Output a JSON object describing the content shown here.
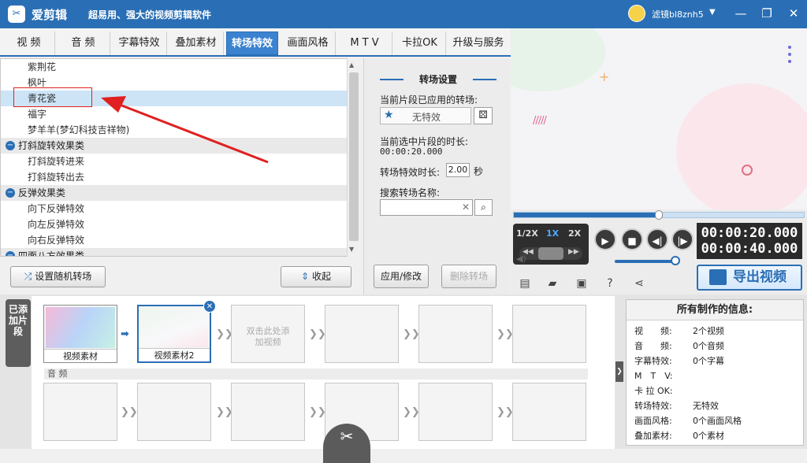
{
  "titlebar": {
    "app_name": "爱剪辑",
    "slogan": "超易用、强大的视频剪辑软件",
    "username": "滤镜bl8znh5"
  },
  "tabs": [
    "视 频",
    "音 频",
    "字幕特效",
    "叠加素材",
    "转场特效",
    "画面风格",
    "M T V",
    "卡拉OK",
    "升级与服务"
  ],
  "active_tab": "转场特效",
  "transition_list": [
    {
      "type": "leaf",
      "label": "紫荆花"
    },
    {
      "type": "leaf",
      "label": "枫叶"
    },
    {
      "type": "leaf",
      "label": "青花瓷",
      "selected": true
    },
    {
      "type": "leaf",
      "label": "福字"
    },
    {
      "type": "leaf",
      "label": "梦羊羊(梦幻科技吉祥物)"
    },
    {
      "type": "category",
      "label": "打斜旋转效果类"
    },
    {
      "type": "leaf",
      "label": "打斜旋转进来"
    },
    {
      "type": "leaf",
      "label": "打斜旋转出去"
    },
    {
      "type": "category",
      "label": "反弹效果类"
    },
    {
      "type": "leaf",
      "label": "向下反弹特效"
    },
    {
      "type": "leaf",
      "label": "向左反弹特效"
    },
    {
      "type": "leaf",
      "label": "向右反弹特效"
    },
    {
      "type": "category",
      "label": "四面八方效果类"
    }
  ],
  "buttons": {
    "random_transition": "设置随机转场",
    "collapse": "收起",
    "apply": "应用/修改",
    "delete": "删除转场"
  },
  "settings": {
    "header": "转场设置",
    "applied_label": "当前片段已应用的转场:",
    "applied_value": "无特效",
    "duration_label": "当前选中片段的时长:",
    "duration_value": "00:00:20.000",
    "effect_duration_label": "转场特效时长:",
    "effect_duration_value": "2.00",
    "seconds_unit": "秒",
    "search_label": "搜索转场名称:",
    "search_value": ""
  },
  "player": {
    "progress": 0.5,
    "speeds": [
      "1/2X",
      "1X",
      "2X"
    ],
    "active_speed": "1X",
    "time_current": "00:00:20.000",
    "time_total": "00:00:40.000",
    "volume": 0.95,
    "export_label": "导出视频"
  },
  "timeline": {
    "side_label": "已添加片段",
    "clips": [
      {
        "caption": "视频素材",
        "kind": "media"
      },
      {
        "caption": "视频素材2",
        "kind": "media",
        "selected": true
      },
      {
        "caption": "双击此处添加视频",
        "kind": "placeholder"
      },
      {
        "caption": "",
        "kind": "empty"
      },
      {
        "caption": "",
        "kind": "empty"
      },
      {
        "caption": "",
        "kind": "empty"
      }
    ],
    "audio_label": "音 频"
  },
  "info": {
    "title": "所有制作的信息:",
    "rows": [
      {
        "k": "视　　频:",
        "v": "2个视频"
      },
      {
        "k": "音　　频:",
        "v": "0个音频"
      },
      {
        "k": "字幕特效:",
        "v": "0个字幕"
      },
      {
        "k": "M　T　V:",
        "v": ""
      },
      {
        "k": "卡 拉 OK:",
        "v": ""
      },
      {
        "k": "转场特效:",
        "v": "无特效"
      },
      {
        "k": "画面风格:",
        "v": "0个画面风格"
      },
      {
        "k": "叠加素材:",
        "v": "0个素材"
      }
    ]
  },
  "colors": {
    "accent": "#2a6fb5",
    "annotation": "#e02020"
  }
}
